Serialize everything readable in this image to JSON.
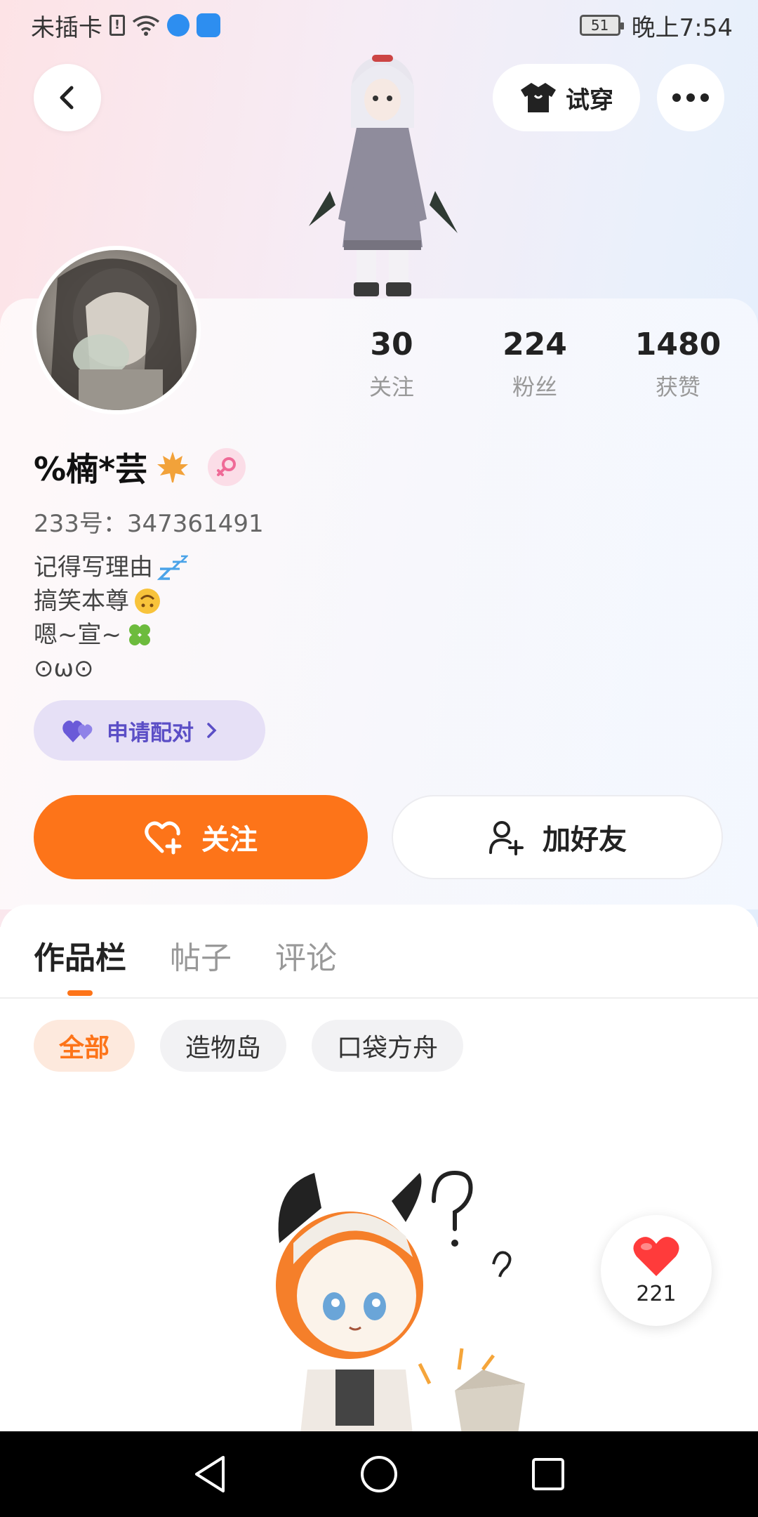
{
  "status_bar": {
    "carrier": "未插卡",
    "battery": "51",
    "time": "晚上7:54"
  },
  "top_bar": {
    "tryon_label": "试穿"
  },
  "profile": {
    "stats": [
      {
        "value": "30",
        "label": "关注"
      },
      {
        "value": "224",
        "label": "粉丝"
      },
      {
        "value": "1480",
        "label": "获赞"
      }
    ],
    "username": "%楠*芸",
    "uid": "233号：347361491",
    "bio": [
      "记得写理由",
      "搞笑本尊",
      "嗯~宣~",
      "⊙ω⊙"
    ],
    "pair_label": "申请配对"
  },
  "actions": {
    "follow_label": "关注",
    "add_friend_label": "加好友"
  },
  "tabs": [
    {
      "label": "作品栏",
      "active": true
    },
    {
      "label": "帖子",
      "active": false
    },
    {
      "label": "评论",
      "active": false
    }
  ],
  "filters": [
    {
      "label": "全部",
      "active": true
    },
    {
      "label": "造物岛",
      "active": false
    },
    {
      "label": "口袋方舟",
      "active": false
    }
  ],
  "like_float": {
    "count": "221"
  },
  "colors": {
    "accent": "#fd7419",
    "pair": "#5b4ec6",
    "pair_bg": "#e6e0f6",
    "heart": "#ff3b3b"
  }
}
